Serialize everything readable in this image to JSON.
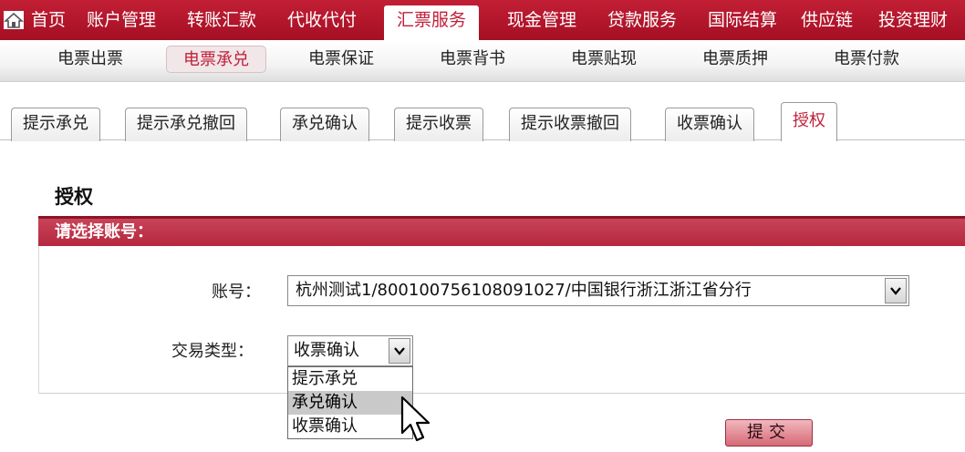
{
  "top_nav": {
    "items": [
      "首页",
      "账户管理",
      "转账汇款",
      "代收代付",
      "汇票服务",
      "现金管理",
      "贷款服务",
      "国际结算",
      "供应链",
      "投资理财"
    ],
    "active": "汇票服务"
  },
  "sub_nav": {
    "items": [
      "电票出票",
      "电票承兑",
      "电票保证",
      "电票背书",
      "电票贴现",
      "电票质押",
      "电票付款"
    ],
    "active": "电票承兑"
  },
  "tabs": {
    "items": [
      "提示承兑",
      "提示承兑撤回",
      "承兑确认",
      "提示收票",
      "提示收票撤回",
      "收票确认",
      "授权"
    ],
    "active": "授权"
  },
  "page_title": "授权",
  "section_title": "请选择账号：",
  "form": {
    "account_label": "账号：",
    "account_value": "杭州测试1/800100756108091027/中国银行浙江浙江省分行",
    "type_label": "交易类型：",
    "type_value": "收票确认",
    "type_options": [
      "提示承兑",
      "承兑确认",
      "收票确认"
    ],
    "type_highlighted": "承兑确认"
  },
  "submit_label": "提交",
  "colors": {
    "brand_red": "#b0132b",
    "section_bar": "#c0354c",
    "active_text": "#c0203a"
  }
}
